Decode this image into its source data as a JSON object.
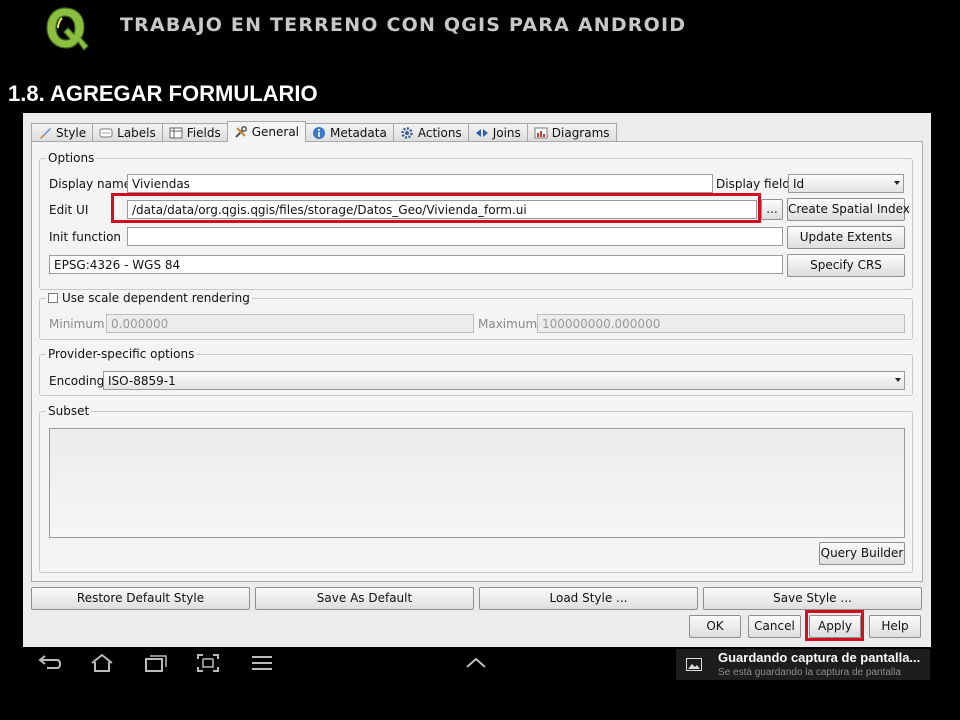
{
  "header": {
    "title": "TRABAJO EN TERRENO CON QGIS PARA ANDROID",
    "section": "1.8. AGREGAR FORMULARIO"
  },
  "tabs": [
    {
      "label": "Style",
      "icon": "brush-icon"
    },
    {
      "label": "Labels",
      "icon": "label-icon"
    },
    {
      "label": "Fields",
      "icon": "table-icon"
    },
    {
      "label": "General",
      "icon": "tools-icon",
      "active": true
    },
    {
      "label": "Metadata",
      "icon": "info-icon"
    },
    {
      "label": "Actions",
      "icon": "gear-icon"
    },
    {
      "label": "Joins",
      "icon": "join-icon"
    },
    {
      "label": "Diagrams",
      "icon": "diagram-icon"
    }
  ],
  "options": {
    "title": "Options",
    "display_name_label": "Display name",
    "display_name_value": "Viviendas",
    "display_field_label": "Display field",
    "display_field_value": "Id",
    "edit_ui_label": "Edit UI",
    "edit_ui_value": "/data/data/org.qgis.qgis/files/storage/Datos_Geo/Vivienda_form.ui",
    "browse_label": "...",
    "create_index_label": "Create Spatial Index",
    "init_function_label": "Init function",
    "init_function_value": "",
    "update_extents_label": "Update Extents",
    "crs_value": "EPSG:4326 - WGS 84",
    "specify_crs_label": "Specify CRS"
  },
  "scale": {
    "title": "Use scale dependent rendering",
    "checked": false,
    "minimum_label": "Minimum",
    "minimum_value": "0.000000",
    "maximum_label": "Maximum",
    "maximum_value": "100000000.000000"
  },
  "provider": {
    "title": "Provider-specific options",
    "encoding_label": "Encoding",
    "encoding_value": "ISO-8859-1"
  },
  "subset": {
    "title": "Subset",
    "query_builder_label": "Query Builder"
  },
  "style_buttons": {
    "restore": "Restore Default Style",
    "save_default": "Save As Default",
    "load": "Load Style ...",
    "save": "Save Style ..."
  },
  "dialog_buttons": {
    "ok": "OK",
    "cancel": "Cancel",
    "apply": "Apply",
    "help": "Help"
  },
  "notification": {
    "title": "Guardando captura de pantalla...",
    "subtitle": "Se está guardando la captura de pantalla"
  },
  "colors": {
    "highlight": "#d0101e",
    "dialog_bg": "#ececec"
  }
}
